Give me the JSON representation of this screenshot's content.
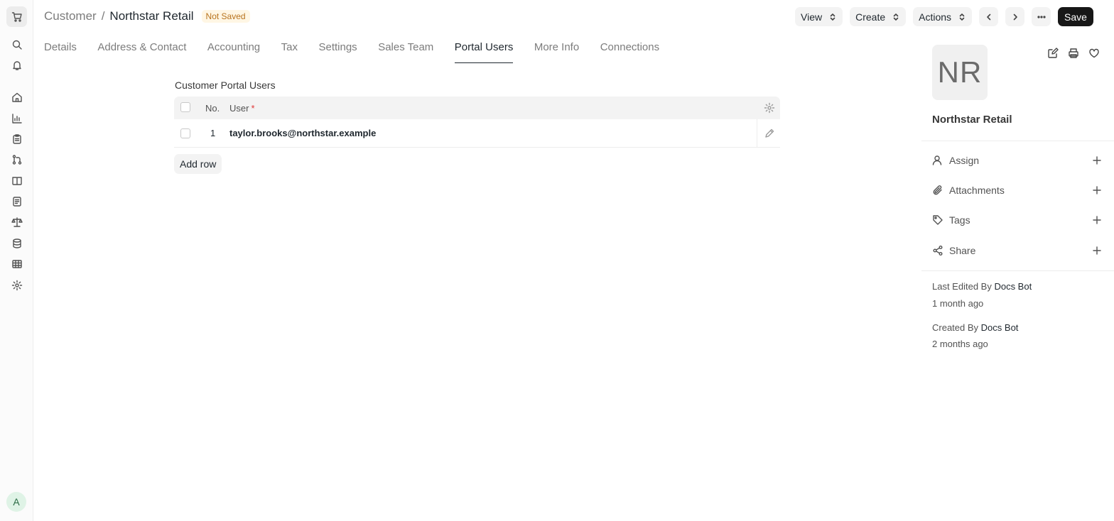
{
  "breadcrumb": {
    "parent": "Customer",
    "separator": "/",
    "current": "Northstar Retail",
    "status_badge": "Not Saved"
  },
  "toolbar": {
    "view_label": "View",
    "create_label": "Create",
    "actions_label": "Actions",
    "save_label": "Save"
  },
  "tabs": [
    {
      "label": "Details"
    },
    {
      "label": "Address & Contact"
    },
    {
      "label": "Accounting"
    },
    {
      "label": "Tax"
    },
    {
      "label": "Settings"
    },
    {
      "label": "Sales Team"
    },
    {
      "label": "Portal Users",
      "active": true
    },
    {
      "label": "More Info"
    },
    {
      "label": "Connections"
    }
  ],
  "portal_users": {
    "section_title": "Customer Portal Users",
    "columns": {
      "no": "No.",
      "user": "User",
      "required_mark": "*"
    },
    "rows": [
      {
        "no": "1",
        "user": "taylor.brooks@northstar.example"
      }
    ],
    "add_row_label": "Add row"
  },
  "sidebar": {
    "avatar_initials": "NR",
    "name": "Northstar Retail",
    "items": [
      {
        "label": "Assign",
        "icon": "user-icon"
      },
      {
        "label": "Attachments",
        "icon": "paperclip-icon"
      },
      {
        "label": "Tags",
        "icon": "tag-icon"
      },
      {
        "label": "Share",
        "icon": "share-icon"
      }
    ],
    "last_edited_prefix": "Last Edited By",
    "last_edited_by": "Docs Bot",
    "last_edited_time": "1 month ago",
    "created_prefix": "Created By",
    "created_by": "Docs Bot",
    "created_time": "2 months ago"
  },
  "user": {
    "avatar_letter": "A"
  }
}
